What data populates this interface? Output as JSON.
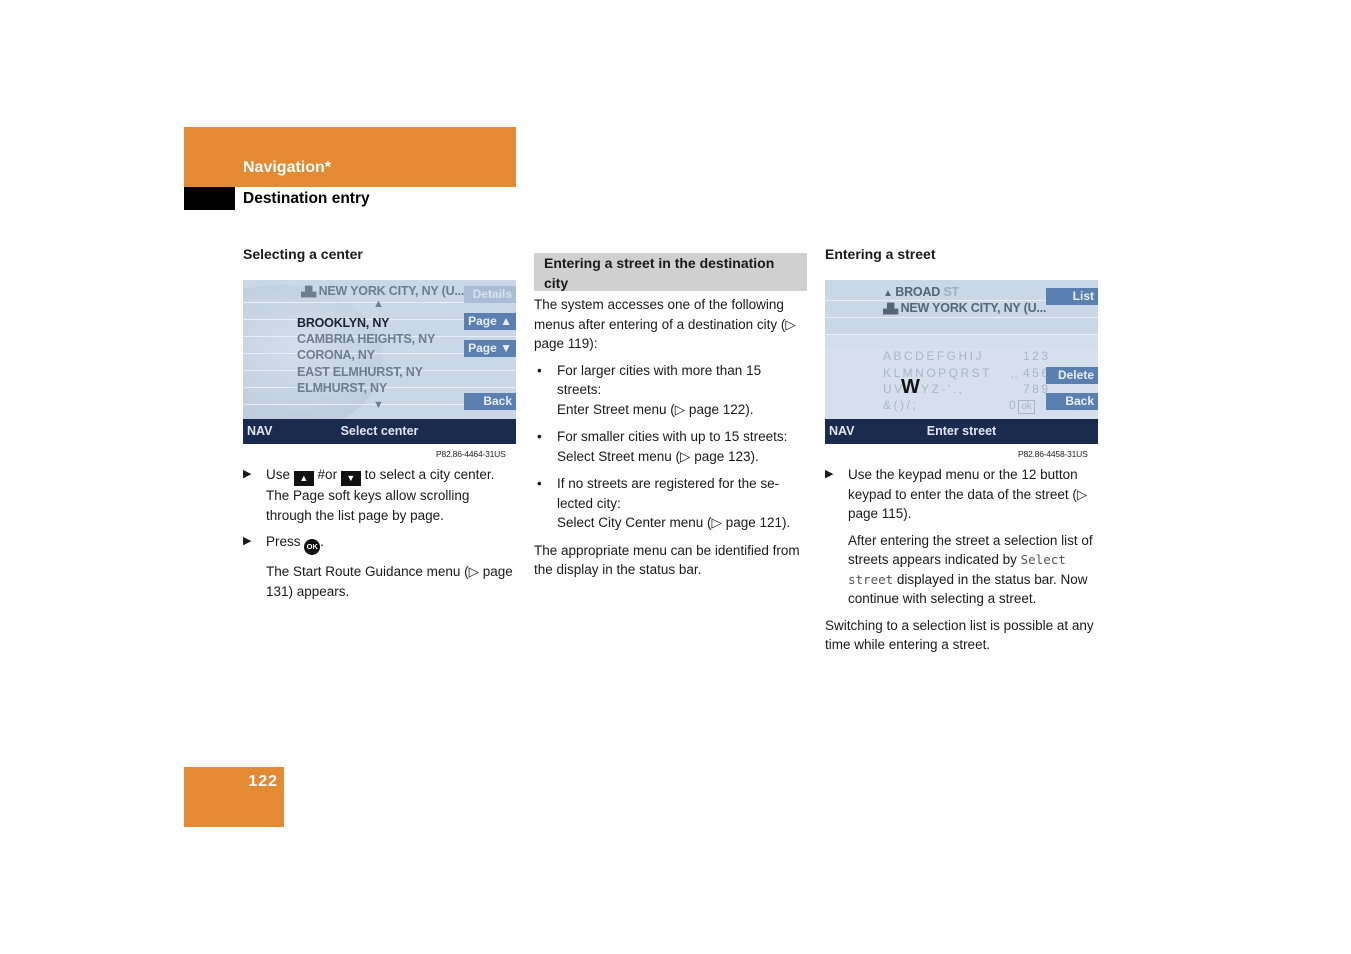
{
  "header": {
    "section_title": "Navigation*",
    "subsection_title": "Destination entry"
  },
  "footer": {
    "page_number": "122"
  },
  "colors": {
    "accent_orange": "#e38a32",
    "status_bar": "#1a2c4e",
    "softkey": "#5c7fb1",
    "screen_bg": "#c9d7e6",
    "section_head_grey": "#d0d0d0"
  },
  "column1": {
    "heading": "Selecting a center",
    "screen": {
      "header_city": "NEW YORK CITY, NY (U...",
      "list": [
        "BROOKLYN, NY",
        "CAMBRIA HEIGHTS, NY",
        "CORONA, NY",
        "EAST ELMHURST, NY",
        "ELMHURST, NY"
      ],
      "selected_index": 0,
      "softkeys": {
        "details": "Details",
        "page_up": "Page ▲",
        "page_down": "Page ▼",
        "back": "Back"
      },
      "status_left": "NAV",
      "status_label": "Select center",
      "up_arrow": "▲",
      "down_arrow": "▼"
    },
    "caption": "P82.86-4464-31US",
    "step1": {
      "pre": "Use",
      "key_up": "▲",
      "mid": "#or",
      "key_down": "▼",
      "post": "to select a city center. The Page soft keys allow scrolling through the list page by page."
    },
    "step2": {
      "pre": "Press",
      "key_ok": "OK",
      "post": "."
    },
    "result": "The Start Route Guidance menu (▷ page 131) appears."
  },
  "column2": {
    "heading": "Entering a street in the destination city",
    "intro": "The system accesses one of the following menus after entering of a destination city (▷ page 119):",
    "bullets": [
      {
        "line1": "For larger cities with more than 15 streets:",
        "line2": "Enter Street menu (▷ page 122)."
      },
      {
        "line1": "For smaller cities with up to 15 streets:",
        "line2": "Select Street menu (▷ page 123)."
      },
      {
        "line1": "If no streets are registered for the se-lected city:",
        "line2": "Select City Center menu (▷ page 121)."
      }
    ],
    "outro": "The appropriate menu can be identified from the display in the status bar."
  },
  "column3": {
    "heading": "Entering a street",
    "screen": {
      "street_input": "BROAD",
      "street_suggest": "ST",
      "city": "NEW YORK CITY, NY (U...",
      "keypad_rows": [
        "ABCDEFGHIJ",
        "KLMNOPQRST",
        "UV XYZ-'.,",
        "&()/;"
      ],
      "number_rows": [
        "123",
        "456",
        "789",
        "0"
      ],
      "ok_label": "ok",
      "cursor_letter": "W",
      "softkeys": {
        "list": "List",
        "delete": "Delete",
        "back": "Back"
      },
      "status_left": "NAV",
      "status_label": "Enter street"
    },
    "caption": "P82.86-4458-31US",
    "step1": "Use the keypad menu or the 12 button keypad to enter the data of the street (▷ page 115).",
    "step1_note_pre": "After entering the street a selection list of streets appears indicated by",
    "step1_note_code": "Select street",
    "step1_note_post": "displayed in the status bar. Now continue with selecting a street.",
    "outro": "Switching to a selection list is possible at any time while entering a street."
  }
}
